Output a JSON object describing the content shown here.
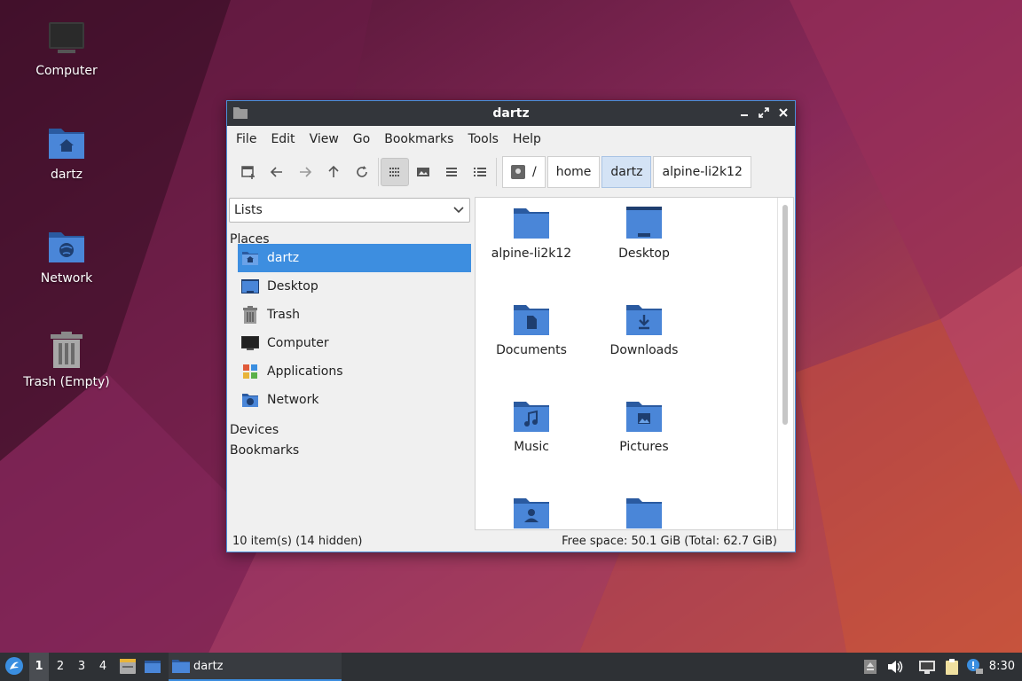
{
  "desktop": {
    "icons": [
      {
        "label": "Computer"
      },
      {
        "label": "dartz"
      },
      {
        "label": "Network"
      },
      {
        "label": "Trash (Empty)"
      }
    ]
  },
  "window": {
    "title": "dartz",
    "menu": [
      "File",
      "Edit",
      "View",
      "Go",
      "Bookmarks",
      "Tools",
      "Help"
    ],
    "pathbar": {
      "root": "/",
      "crumbs": [
        "home",
        "dartz",
        "alpine-li2k12"
      ],
      "current": "dartz"
    },
    "sidepanel": {
      "mode": "Lists",
      "sections": {
        "places": "Places",
        "devices": "Devices",
        "bookmarks": "Bookmarks"
      },
      "places": [
        {
          "label": "dartz",
          "icon": "home-folder-icon",
          "selected": true
        },
        {
          "label": "Desktop",
          "icon": "desktop-icon"
        },
        {
          "label": "Trash",
          "icon": "trash-icon"
        },
        {
          "label": "Computer",
          "icon": "computer-icon"
        },
        {
          "label": "Applications",
          "icon": "applications-icon"
        },
        {
          "label": "Network",
          "icon": "network-icon"
        }
      ]
    },
    "items": [
      {
        "label": "alpine-li2k12",
        "icon": "folder-icon"
      },
      {
        "label": "Desktop",
        "icon": "desktop-folder-icon"
      },
      {
        "label": "Documents",
        "icon": "documents-folder-icon"
      },
      {
        "label": "Downloads",
        "icon": "downloads-folder-icon"
      },
      {
        "label": "Music",
        "icon": "music-folder-icon"
      },
      {
        "label": "Pictures",
        "icon": "pictures-folder-icon"
      },
      {
        "label": "",
        "icon": "public-folder-icon"
      },
      {
        "label": "",
        "icon": "folder-icon"
      }
    ],
    "status": {
      "items": "10 item(s) (14 hidden)",
      "space": "Free space: 50.1 GiB (Total: 62.7 GiB)"
    }
  },
  "taskbar": {
    "workspaces": [
      "1",
      "2",
      "3",
      "4"
    ],
    "active_workspace": "1",
    "task_label": "dartz",
    "clock": "8:30"
  },
  "colors": {
    "accent": "#3d8ee0",
    "folder": "#4a86d8",
    "folder_dark": "#2a5aa0",
    "titlebar": "#33363b",
    "taskbar": "#2e3135"
  }
}
